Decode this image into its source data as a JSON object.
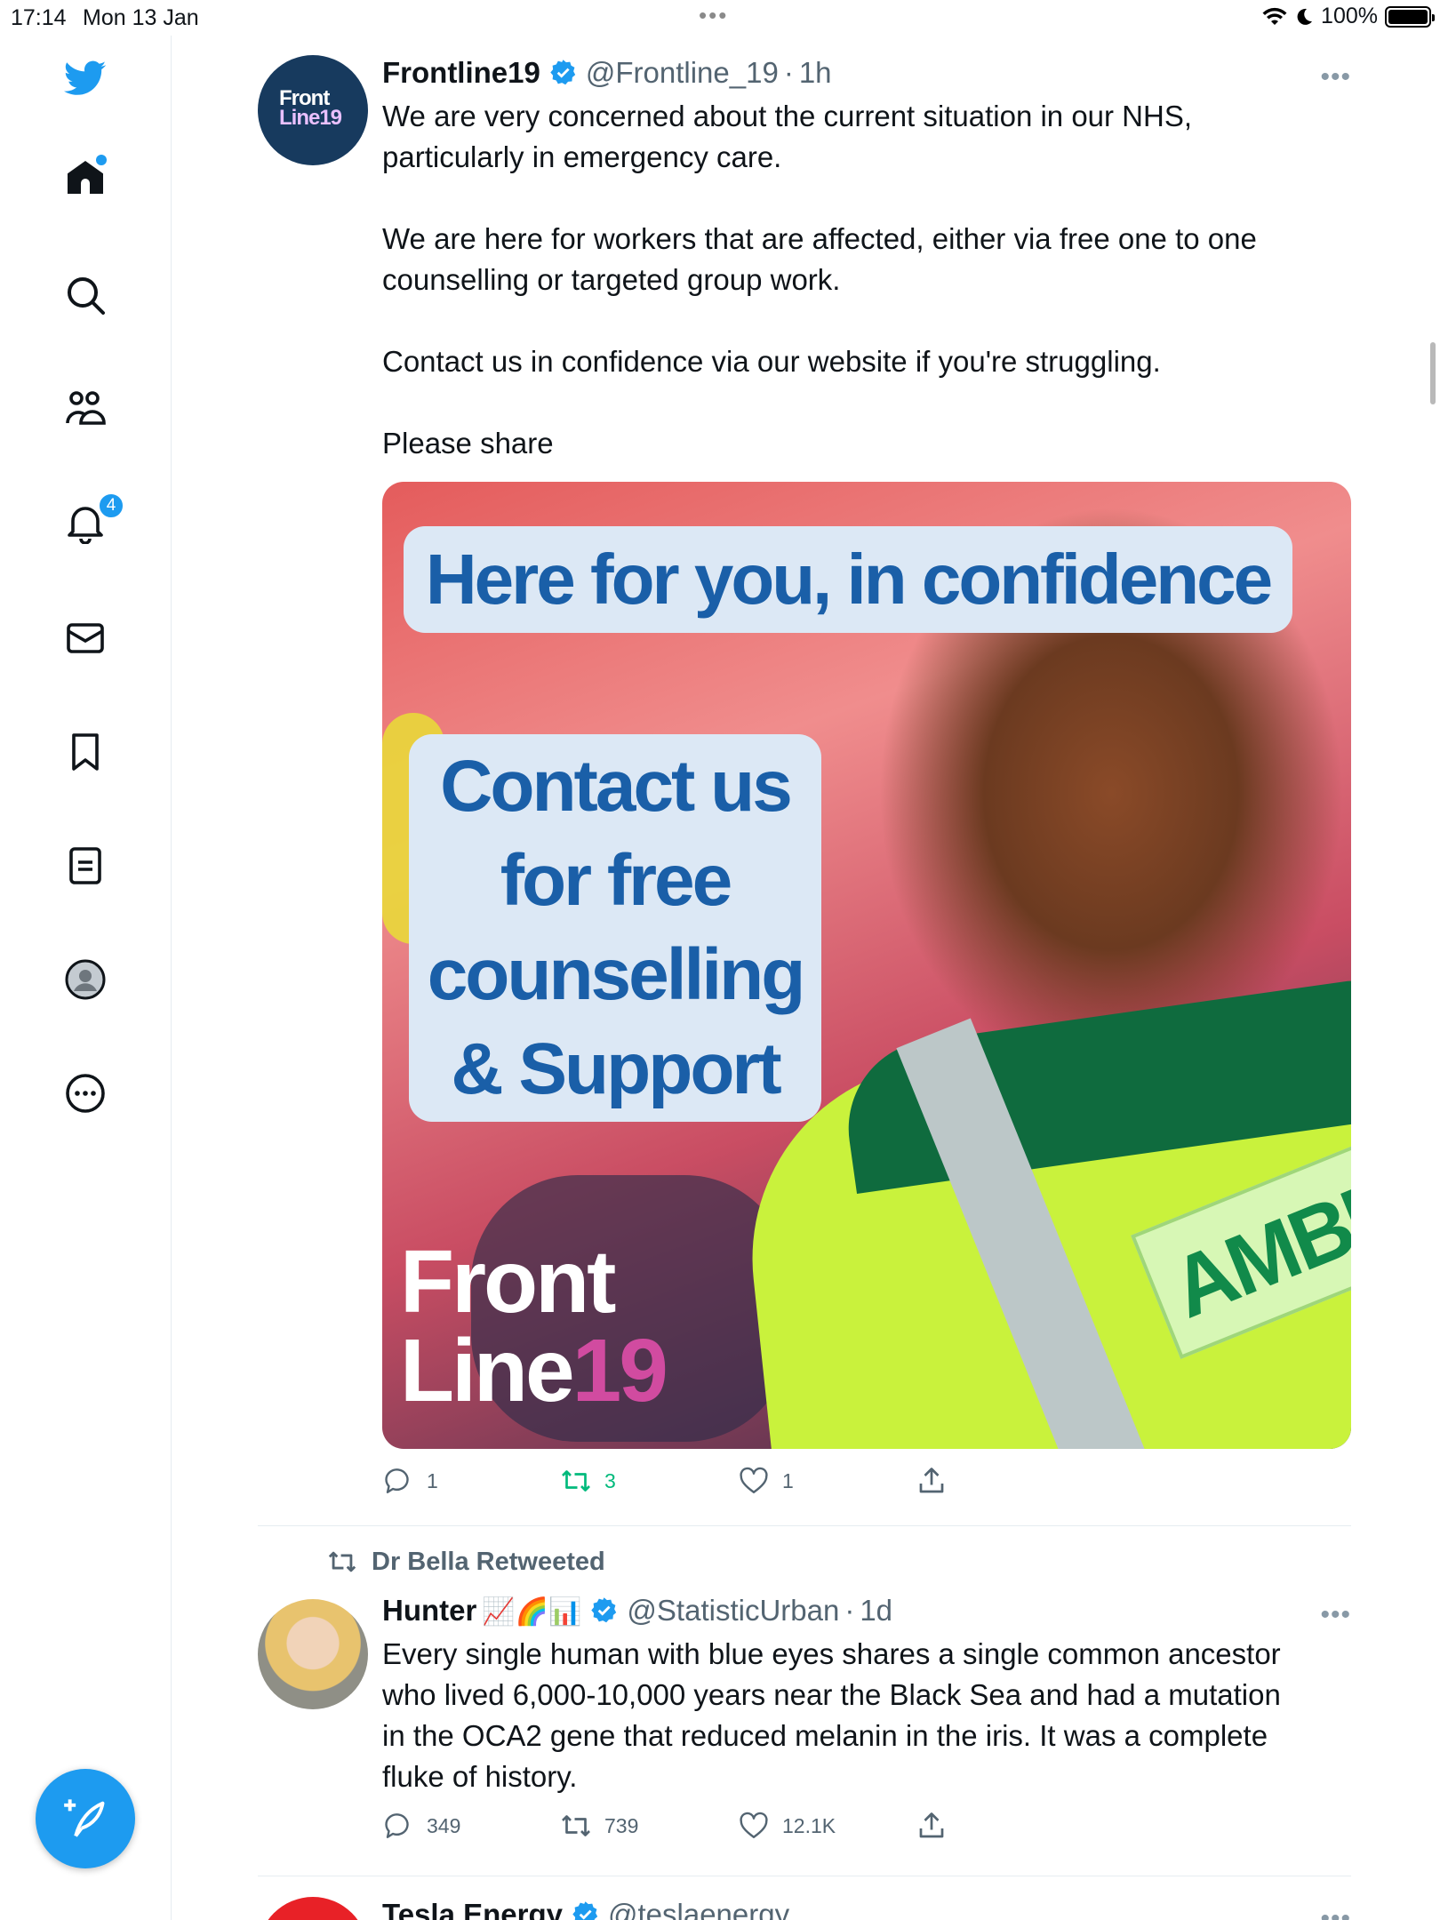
{
  "status_bar": {
    "time": "17:14",
    "date": "Mon 13 Jan",
    "battery": "100%",
    "center_dots": "•••"
  },
  "sidebar": {
    "items": [
      {
        "name": "twitter-logo",
        "icon": "twitter-bird-icon"
      },
      {
        "name": "home",
        "icon": "home-icon"
      },
      {
        "name": "explore",
        "icon": "search-icon"
      },
      {
        "name": "communities",
        "icon": "people-icon"
      },
      {
        "name": "notifications",
        "icon": "bell-icon",
        "badge": "4"
      },
      {
        "name": "messages",
        "icon": "envelope-icon"
      },
      {
        "name": "bookmarks",
        "icon": "bookmark-icon"
      },
      {
        "name": "lists",
        "icon": "list-icon"
      },
      {
        "name": "profile",
        "icon": "avatar-icon"
      },
      {
        "name": "more",
        "icon": "more-circle-icon"
      }
    ],
    "compose_icon": "compose-feather-icon"
  },
  "tweets": [
    {
      "name": "Frontline19",
      "handle": "@Frontline_19",
      "time": "1h",
      "text": "We are very concerned about the current situation in our NHS,\nparticularly in emergency care.\n\nWe are here for workers that are affected, either via free one to one\ncounselling or targeted group work.\n\nContact us in confidence via our website if you're struggling.\n\nPlease share",
      "avatar_text": [
        "Front",
        "Line19"
      ],
      "media": {
        "headline": "Here for you, in confidence",
        "main": [
          "Contact us",
          "for free",
          "counselling",
          "& Support"
        ],
        "logo_line1": "Front",
        "logo_line2a": "Line",
        "logo_line2b": "19",
        "ambulance_text": "AMBU"
      },
      "replies": "1",
      "retweets": "3",
      "likes": "1"
    },
    {
      "retweeted_by": "Dr Bella Retweeted",
      "name": "Hunter",
      "name_emojis": "📈🌈📊",
      "handle": "@StatisticUrban",
      "time": "1d",
      "text": "Every single human with blue eyes shares a single common ancestor\nwho lived 6,000-10,000 years near the Black Sea and had a mutation\nin the OCA2 gene that reduced melanin in the iris. It was a complete\nfluke of history.",
      "replies": "349",
      "retweets": "739",
      "likes": "12.1K"
    },
    {
      "name": "Tesla Energy",
      "handle": "@teslaenergy"
    }
  ],
  "colors": {
    "accent": "#1d9bf0",
    "retweet_active": "#00ba7c",
    "muted": "#536471"
  }
}
